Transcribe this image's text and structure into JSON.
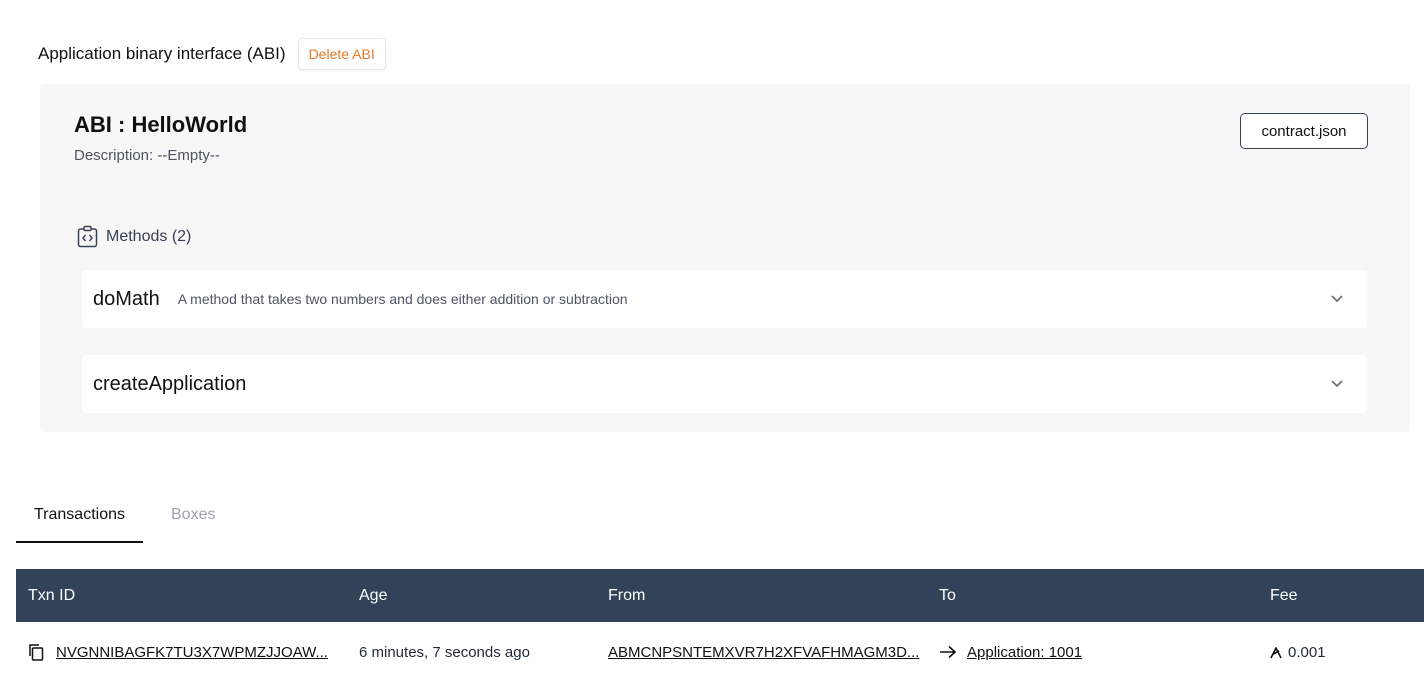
{
  "abi_section": {
    "title": "Application binary interface (ABI)",
    "delete_label": "Delete ABI"
  },
  "abi": {
    "name": "ABI : HelloWorld",
    "description": "Description: --Empty--",
    "file_button": "contract.json",
    "methods_heading": "Methods (2)",
    "methods": [
      {
        "name": "doMath",
        "description": "A method that takes two numbers and does either addition or subtraction"
      },
      {
        "name": "createApplication",
        "description": ""
      }
    ]
  },
  "tabs": [
    {
      "label": "Transactions",
      "active": true
    },
    {
      "label": "Boxes",
      "active": false
    }
  ],
  "table": {
    "headers": [
      "Txn ID",
      "Age",
      "From",
      "To",
      "Fee"
    ],
    "rows": [
      {
        "txn_id": "NVGNNIBAGFK7TU3X7WPMZJJOAW...",
        "age": "6 minutes, 7 seconds ago",
        "from": "ABMCNPSNTEMXVR7H2XFVAFHMAGM3D...",
        "to": "Application: 1001",
        "fee": "0.001"
      }
    ]
  },
  "colors": {
    "table_header_bg": "#324359",
    "panel_bg": "#f7f7f8",
    "delete_accent": "#e07a2a"
  }
}
